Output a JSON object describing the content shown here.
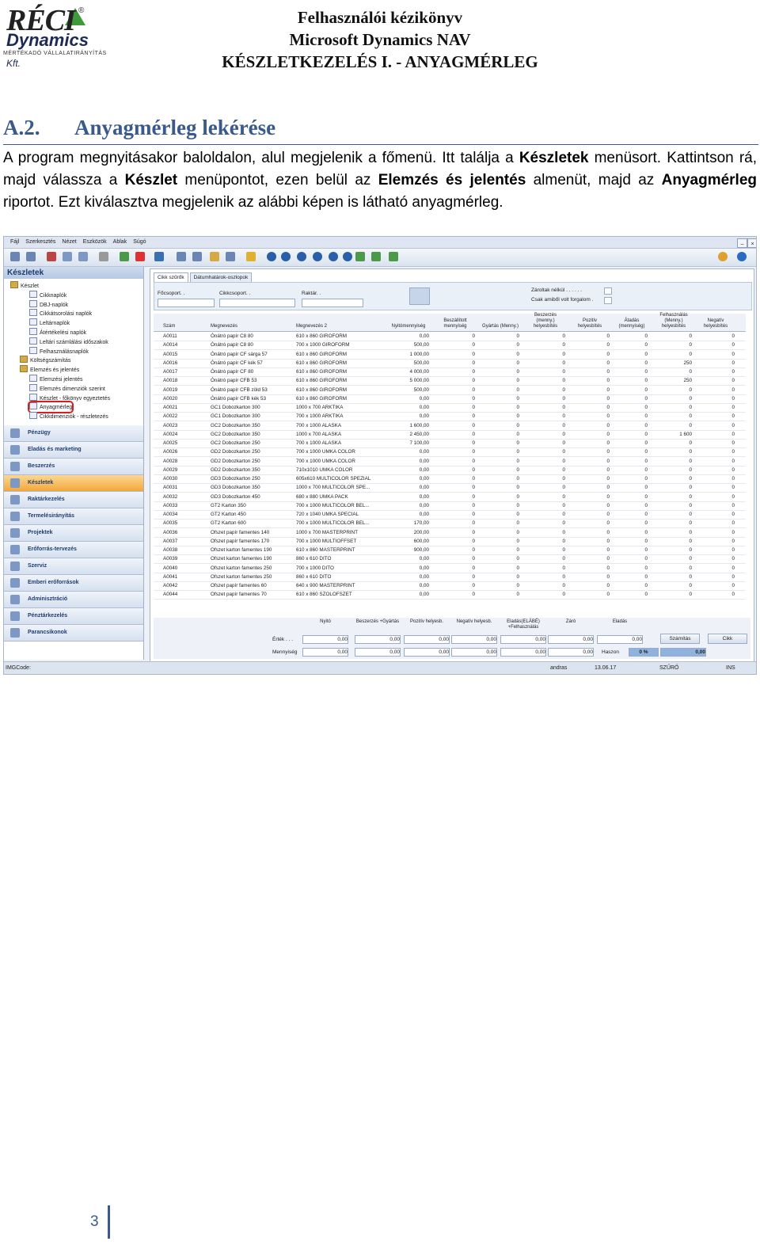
{
  "logo": {
    "line1": "RÉCI",
    "line2": "Dynamics",
    "kft": "Kft.",
    "tagline": "MÉRTÉKADÓ VÁLLALATIRÁNYÍTÁS",
    "reg": "®"
  },
  "header": {
    "line1": "Felhasználói kézikönyv",
    "line2": "Microsoft Dynamics NAV",
    "line3": "KÉSZLETKEZELÉS I. - ANYAGMÉRLEG"
  },
  "section": {
    "number": "A.2.",
    "title": "Anyagmérleg lekérése"
  },
  "paragraph": {
    "p1": "A program megnyitásakor baloldalon, alul megjelenik a főmenü. Itt találja a ",
    "b1": "Készletek",
    "p2": " menüsort. Kattintson rá, majd válassza a ",
    "b2": "Készlet",
    "p3": " menüpontot, ezen belül az ",
    "b3": "Elemzés és jelentés",
    "p4": " almenüt, majd az ",
    "b4": "Anyagmérleg",
    "p5": " riportot. Ezt kiválasztva megjelenik az alábbi képen is látható anyagmérleg."
  },
  "screenshot": {
    "menu": [
      "Fájl",
      "Szerkesztés",
      "Nézet",
      "Eszközök",
      "Ablak",
      "Súgó"
    ],
    "nav_title": "Készletek",
    "tree": [
      {
        "label": "Készlet",
        "level": 0,
        "kind": "folder"
      },
      {
        "label": "Cikknaplók",
        "level": 2,
        "kind": "doc"
      },
      {
        "label": "DBJ-naplók",
        "level": 2,
        "kind": "doc"
      },
      {
        "label": "Cikkátsorolási naplók",
        "level": 2,
        "kind": "doc"
      },
      {
        "label": "Leltárnaplók",
        "level": 2,
        "kind": "doc"
      },
      {
        "label": "Átértékelési naplók",
        "level": 2,
        "kind": "doc"
      },
      {
        "label": "Leltári számlálási időszakok",
        "level": 2,
        "kind": "doc"
      },
      {
        "label": "Felhasználásnaplók",
        "level": 2,
        "kind": "doc"
      },
      {
        "label": "Költségszámítás",
        "level": 1,
        "kind": "folder"
      },
      {
        "label": "Elemzés és jelentés",
        "level": 1,
        "kind": "folder"
      },
      {
        "label": "Elemzési jelentés",
        "level": 2,
        "kind": "doc"
      },
      {
        "label": "Elemzés dimenziók szerint",
        "level": 2,
        "kind": "doc"
      },
      {
        "label": "Készlet - főkönyv egyeztetés",
        "level": 2,
        "kind": "doc"
      },
      {
        "label": "Anyagmérleg",
        "level": 2,
        "kind": "doc"
      },
      {
        "label": "Cikkdimenziók - részletezés",
        "level": 2,
        "kind": "doc"
      }
    ],
    "nav_buttons": [
      "Pénzügy",
      "Eladás és marketing",
      "Beszerzés",
      "Készletek",
      "Raktárkezelés",
      "Termelésirányítás",
      "Projektek",
      "Erőforrás-tervezés",
      "Szerviz",
      "Emberi erőforrások",
      "Adminisztráció",
      "Pénztárkezelés",
      "Parancsikonok"
    ],
    "tabs": [
      "Cikk szűrők",
      "Dátumhatárok-oszlopok"
    ],
    "filters": {
      "focsoport": "Főcsoport. .",
      "cikkcsoport": "Cikkcsoport. .",
      "raktar": "Raktár. .",
      "zarolt": "Zároltak nélkül . . . . . .",
      "csak": "Csak amiből volt forgalom ."
    },
    "columns": [
      "Szám",
      "Megnevezés",
      "Megnevezés 2",
      "Nyitómennyiség",
      "Beszállított mennyiség",
      "Gyártás (Menny.)",
      "Beszerzés (menny.) helyesbítés",
      "Pozitív helyesbítés",
      "Átadás (mennyiség)",
      "Felhasználás (Menny.) helyesbítés",
      "Negatív helyesbítés"
    ],
    "rows": [
      [
        "A0011",
        "Ónátró papír C8 80",
        "610 x 860 GIROFORM",
        "0,00",
        "0",
        "0",
        "0",
        "0",
        "0",
        "0",
        "0"
      ],
      [
        "A0014",
        "Ónátró papír C8 80",
        "700 x 1000 GIROFORM",
        "500,00",
        "0",
        "0",
        "0",
        "0",
        "0",
        "0",
        "0"
      ],
      [
        "A0015",
        "Ónátró papír CF sárga 57",
        "610 x 860 GIROFORM",
        "1 000,00",
        "0",
        "0",
        "0",
        "0",
        "0",
        "0",
        "0"
      ],
      [
        "A0016",
        "Ónátró papír CF kék 57",
        "610 x 860 GIROFORM",
        "500,00",
        "0",
        "0",
        "0",
        "0",
        "0",
        "250",
        "0"
      ],
      [
        "A0017",
        "Ónátró papír CF 80",
        "610 x 860 GIROFORM",
        "4 000,00",
        "0",
        "0",
        "0",
        "0",
        "0",
        "0",
        "0"
      ],
      [
        "A0018",
        "Ónátró papír CFB 53",
        "610 x 860 GIROFORM",
        "5 000,00",
        "0",
        "0",
        "0",
        "0",
        "0",
        "250",
        "0"
      ],
      [
        "A0019",
        "Ónátró papír CFB zöld 53",
        "610 x 860 GIROFORM",
        "500,00",
        "0",
        "0",
        "0",
        "0",
        "0",
        "0",
        "0"
      ],
      [
        "A0020",
        "Ónátró papír CFB kék 53",
        "610 x 860 GIROFORM",
        "0,00",
        "0",
        "0",
        "0",
        "0",
        "0",
        "0",
        "0"
      ],
      [
        "A0021",
        "GC1 Dobozkarton 300",
        "1000 x 700 ARKTIKA",
        "0,00",
        "0",
        "0",
        "0",
        "0",
        "0",
        "0",
        "0"
      ],
      [
        "A0022",
        "GC1 Dobozkarton 300",
        "700 x 1000 ARKTIKA",
        "0,00",
        "0",
        "0",
        "0",
        "0",
        "0",
        "0",
        "0"
      ],
      [
        "A0023",
        "GC2 Dobozkarton 350",
        "700 x 1000 ALASKA",
        "1 600,00",
        "0",
        "0",
        "0",
        "0",
        "0",
        "0",
        "0"
      ],
      [
        "A0024",
        "GC2 Dobozkarton 350",
        "1000 x 700 ALASKA",
        "2 450,00",
        "0",
        "0",
        "0",
        "0",
        "0",
        "1 600",
        "0"
      ],
      [
        "A0025",
        "GC2 Dobozkarton 250",
        "700 x 1000 ALASKA",
        "7 100,00",
        "0",
        "0",
        "0",
        "0",
        "0",
        "0",
        "0"
      ],
      [
        "A0026",
        "GD2 Dobozkarton 250",
        "700 x 1000 UMKA COLOR",
        "0,00",
        "0",
        "0",
        "0",
        "0",
        "0",
        "0",
        "0"
      ],
      [
        "A0028",
        "GD2 Dobozkarton 250",
        "700 x 1000 UMKA COLOR",
        "0,00",
        "0",
        "0",
        "0",
        "0",
        "0",
        "0",
        "0"
      ],
      [
        "A0029",
        "GD2 Dobozkarton 350",
        "710x1010 UMKA COLOR",
        "0,00",
        "0",
        "0",
        "0",
        "0",
        "0",
        "0",
        "0"
      ],
      [
        "A0030",
        "GD3 Dobozkarton 250",
        "605x610 MULTICOLOR SPEZIAL",
        "0,00",
        "0",
        "0",
        "0",
        "0",
        "0",
        "0",
        "0"
      ],
      [
        "A0031",
        "GD3 Dobozkarton 350",
        "1000 x 700 MULTICOLOR SPE...",
        "0,00",
        "0",
        "0",
        "0",
        "0",
        "0",
        "0",
        "0"
      ],
      [
        "A0032",
        "GD3 Dobozkarton 450",
        "680 x 880 UMKA PACK",
        "0,00",
        "0",
        "0",
        "0",
        "0",
        "0",
        "0",
        "0"
      ],
      [
        "A0033",
        "GT2 Karton 350",
        "700 x 1000 MULTICOLOR BEL...",
        "0,00",
        "0",
        "0",
        "0",
        "0",
        "0",
        "0",
        "0"
      ],
      [
        "A0034",
        "GT2 Karton 450",
        "720 x 1040 UMKA SPECIAL",
        "0,00",
        "0",
        "0",
        "0",
        "0",
        "0",
        "0",
        "0"
      ],
      [
        "A0035",
        "GT2 Karton 600",
        "700 x 1000 MULTICOLOR BEL...",
        "170,00",
        "0",
        "0",
        "0",
        "0",
        "0",
        "0",
        "0"
      ],
      [
        "A0036",
        "Ofszet papír famentes 140",
        "1000 x 700 MASTERPRINT",
        "200,00",
        "0",
        "0",
        "0",
        "0",
        "0",
        "0",
        "0"
      ],
      [
        "A0037",
        "Ofszet papír famentes 170",
        "700 x 1000 MULTIOFFSET",
        "600,00",
        "0",
        "0",
        "0",
        "0",
        "0",
        "0",
        "0"
      ],
      [
        "A0038",
        "Ofszet karton famentes 190",
        "610 x 860 MASTERPRINT",
        "900,00",
        "0",
        "0",
        "0",
        "0",
        "0",
        "0",
        "0"
      ],
      [
        "A0039",
        "Ofszet karton famentes 190",
        "860 x 610 DITO",
        "0,00",
        "0",
        "0",
        "0",
        "0",
        "0",
        "0",
        "0"
      ],
      [
        "A0040",
        "Ofszet karton famentes 250",
        "700 x 1000 DITO",
        "0,00",
        "0",
        "0",
        "0",
        "0",
        "0",
        "0",
        "0"
      ],
      [
        "A0041",
        "Ofszet karton famentes 250",
        "860 x 610 DITO",
        "0,00",
        "0",
        "0",
        "0",
        "0",
        "0",
        "0",
        "0"
      ],
      [
        "A0042",
        "Ofszet papír famentes 60",
        "640 x 900 MASTERPRINT",
        "0,00",
        "0",
        "0",
        "0",
        "0",
        "0",
        "0",
        "0"
      ],
      [
        "A0044",
        "Ofszet papír famentes 70",
        "610 x 860 SZOLOFSZET",
        "0,00",
        "0",
        "0",
        "0",
        "0",
        "0",
        "0",
        "0"
      ]
    ],
    "totals": {
      "headers": [
        "Nyitó",
        "Beszerzés +Gyártás",
        "Pozitív helyesb.",
        "Negatív helyesb.",
        "Eladás(ELÁBÉ) +Felhasználás",
        "Záró",
        "Eladás"
      ],
      "ertek_label": "Érték . . .",
      "ertek": [
        "0,00",
        "0,00",
        "0,00",
        "0,00",
        "0,00",
        "0,00",
        "0,00"
      ],
      "menny_label": "Mennyiség",
      "menny": [
        "0,00",
        "0,00",
        "0,00",
        "0,00",
        "0,00",
        "0,00"
      ],
      "haszon_label": "Haszon",
      "haszon_pct": "0 %",
      "haszon_val": "0,00",
      "btn_calc": "Számítás",
      "btn_cikk": "Cikk"
    },
    "status": {
      "left": "IMGCode:",
      "user": "andras",
      "date": "13.06.17",
      "filter": "SZŰRŐ",
      "ins": "INS"
    }
  },
  "page": {
    "number": "3"
  }
}
